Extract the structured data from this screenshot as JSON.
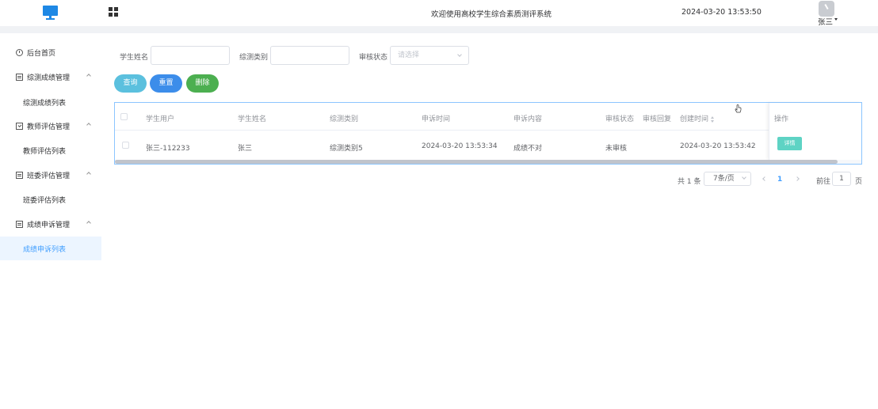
{
  "header": {
    "title": "欢迎使用高校学生综合素质测评系统",
    "datetime": "2024-03-20 13:53:50",
    "user": "张三"
  },
  "sidebar": {
    "items": [
      {
        "label": "后台首页",
        "icon": "clock-icon"
      },
      {
        "label": "综测成绩管理",
        "icon": "document-icon"
      },
      {
        "label": "综测成绩列表"
      },
      {
        "label": "教师评估管理",
        "icon": "checkbox-icon"
      },
      {
        "label": "教师评估列表"
      },
      {
        "label": "班委评估管理",
        "icon": "document-icon"
      },
      {
        "label": "班委评估列表"
      },
      {
        "label": "成绩申诉管理",
        "icon": "document-icon"
      },
      {
        "label": "成绩申诉列表",
        "active": true
      }
    ]
  },
  "filters": {
    "student_name_label": "学生姓名",
    "category_label": "综测类别",
    "status_label": "审核状态",
    "status_placeholder": "请选择"
  },
  "buttons": {
    "query": "查询",
    "reset": "重置",
    "delete": "删除",
    "detail": "详情"
  },
  "table": {
    "columns": [
      "学生用户",
      "学生姓名",
      "综测类别",
      "申诉时间",
      "申诉内容",
      "审核状态",
      "审核回复",
      "创建时间",
      "操作"
    ],
    "rows": [
      {
        "student_user": "张三-112233",
        "student_name": "张三",
        "category": "综测类别5",
        "appeal_time": "2024-03-20 13:53:34",
        "appeal_content": "成绩不对",
        "review_status": "未审核",
        "review_reply": "",
        "created_time": "2024-03-20 13:53:42"
      }
    ]
  },
  "pagination": {
    "total": "共 1 条",
    "page_size": "7条/页",
    "current_page": "1",
    "goto_label": "前往",
    "goto_value": "1",
    "page_suffix": "页"
  },
  "colors": {
    "accent": "#409eff",
    "query": "#5bc0de",
    "reset": "#3c8dea",
    "delete": "#4caf50",
    "detail": "#5ed3c4"
  }
}
